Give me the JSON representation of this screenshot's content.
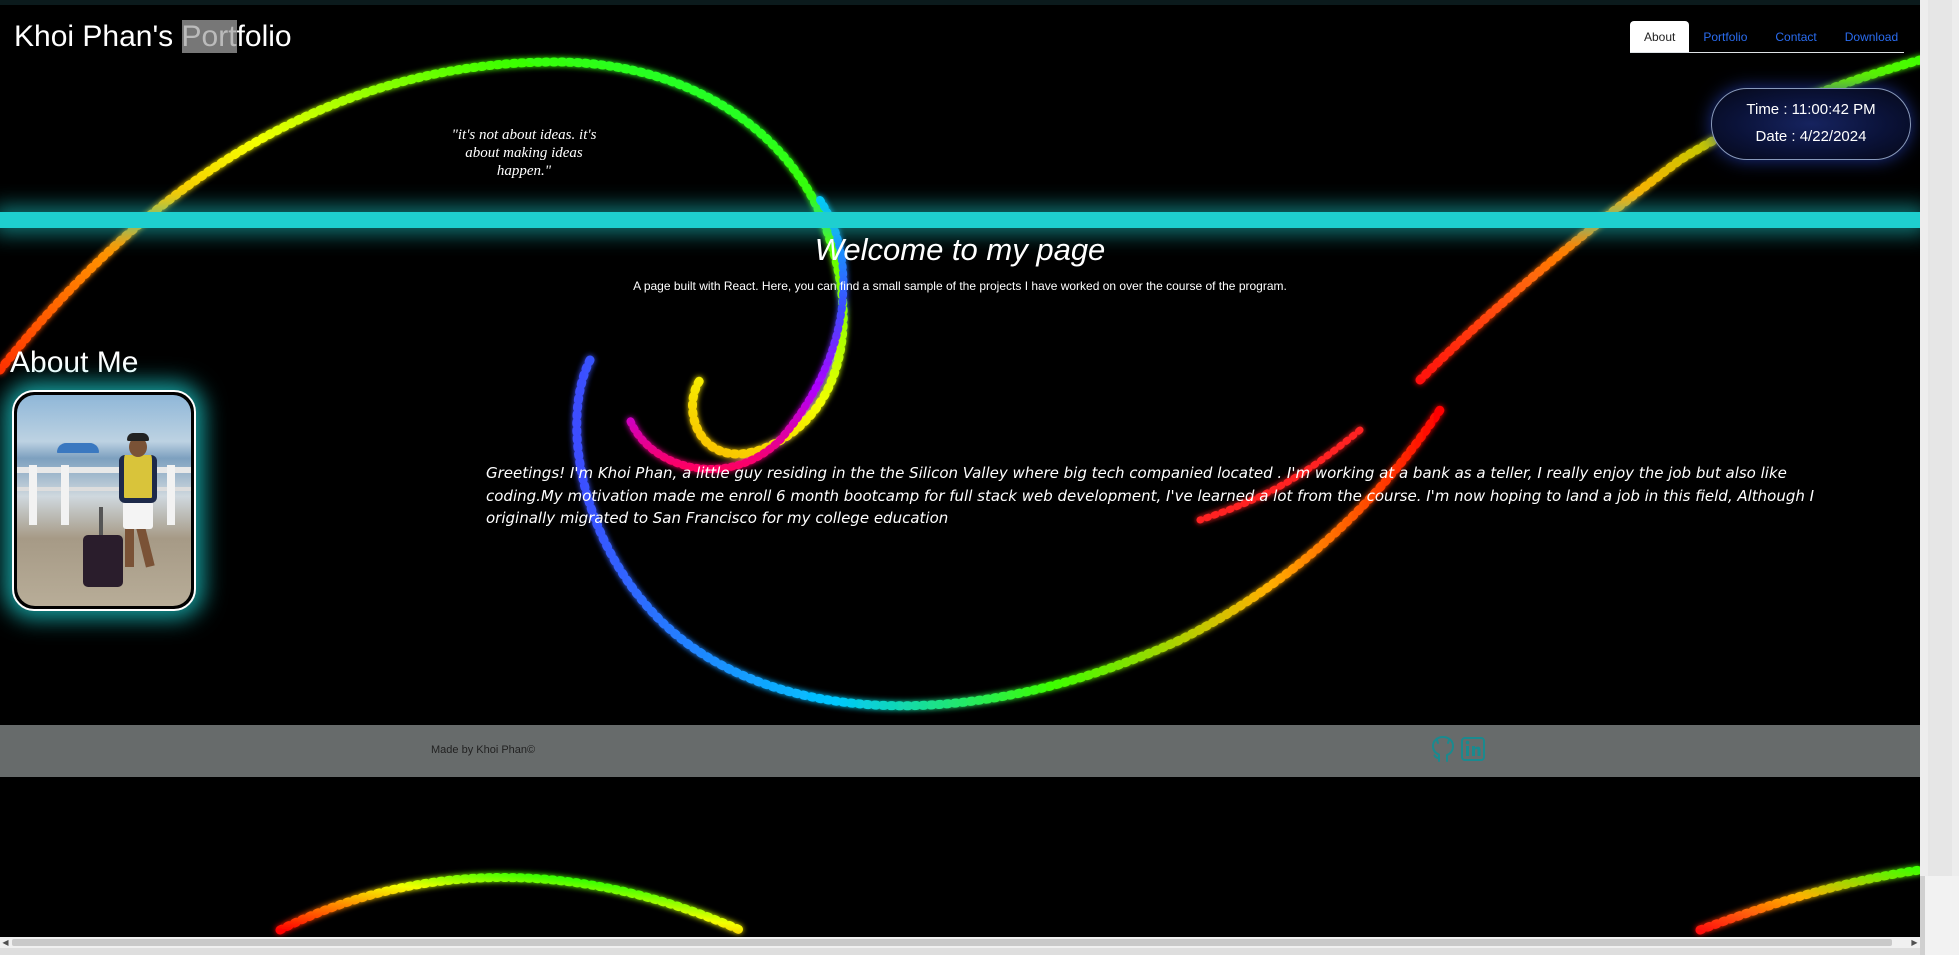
{
  "header": {
    "title_before": "Khoi Phan's ",
    "title_highlight": "Port",
    "title_after": "folio"
  },
  "nav": {
    "items": [
      "About",
      "Portfolio",
      "Contact",
      "Download"
    ],
    "active": "About"
  },
  "clock": {
    "time_label": "Time : 11:00:42 PM",
    "date_label": "Date : 4/22/2024"
  },
  "quote": "\"it's not about ideas. it's about making ideas happen.\"",
  "hero": {
    "title": "Welcome to my page",
    "subtitle": "A page built with React. Here, you can find a small sample of the projects I have worked on over the course of the program."
  },
  "about": {
    "title": "About Me",
    "bio": "Greetings! I'm Khoi Phan, a little guy residing in the the Silicon Valley where big tech companied located . I'm working at a bank as a teller, I really enjoy the job but also like coding.My motivation made me enroll 6 month bootcamp for full stack web development, I've learned a lot from the course. I'm now hoping to land a job in this field, Although I originally migrated to San Francisco for my college education"
  },
  "footer": {
    "credit": "Made by Khoi Phan©",
    "icons": [
      "github-icon",
      "linkedin-icon"
    ]
  },
  "colors": {
    "accent_cyan": "#1ecfcf",
    "nav_link": "#2a6cf0",
    "footer_bg": "#676b6b",
    "icon_teal": "#1a8a8f"
  }
}
